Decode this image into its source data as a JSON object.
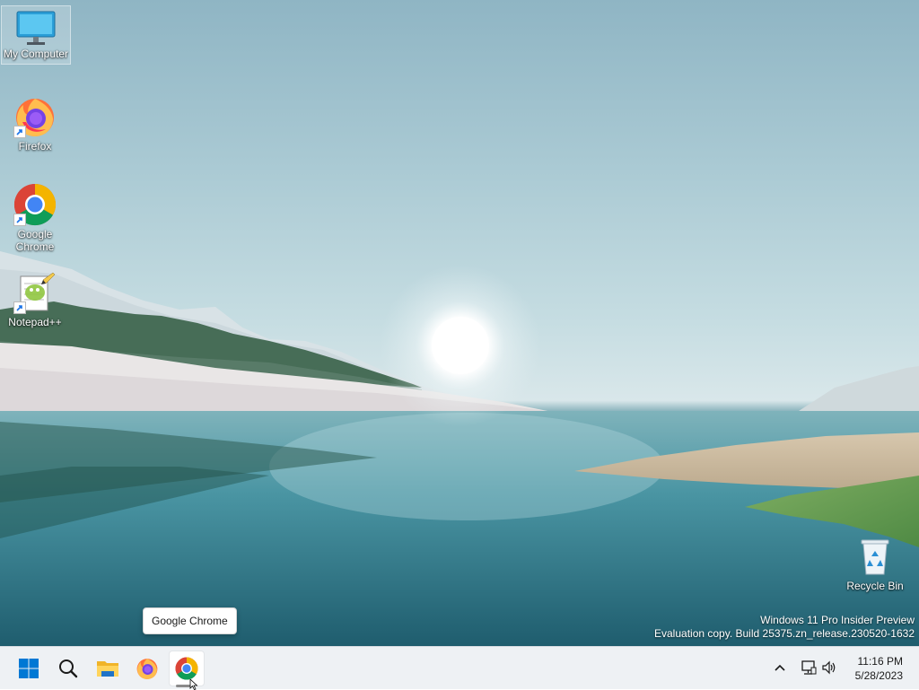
{
  "desktop_icons": [
    {
      "id": "my-computer",
      "label": "My Computer",
      "selected": true
    },
    {
      "id": "firefox",
      "label": "Firefox",
      "shortcut": true
    },
    {
      "id": "google-chrome",
      "label": "Google Chrome",
      "shortcut": true
    },
    {
      "id": "notepadpp",
      "label": "Notepad++",
      "shortcut": true
    },
    {
      "id": "recycle-bin",
      "label": "Recycle Bin"
    }
  ],
  "watermark": {
    "line1": "Windows 11 Pro Insider Preview",
    "line2": "Evaluation copy. Build 25375.zn_release.230520-1632"
  },
  "tooltip": {
    "text": "Google Chrome"
  },
  "taskbar": {
    "buttons": [
      {
        "name": "start",
        "icon": "windows-logo-icon"
      },
      {
        "name": "search",
        "icon": "search-icon"
      },
      {
        "name": "file-explorer",
        "icon": "folder-icon"
      },
      {
        "name": "firefox",
        "icon": "firefox-icon"
      },
      {
        "name": "google-chrome",
        "icon": "chrome-icon",
        "active": true
      }
    ],
    "tray_icons": [
      "chevron-up-icon",
      "network-icon",
      "volume-icon"
    ],
    "clock": {
      "time": "11:16 PM",
      "date": "5/28/2023"
    }
  },
  "colors": {
    "taskbar_bg": "#eef1f4",
    "windows_blue": "#0078d4",
    "chrome_red": "#db4437",
    "chrome_yellow": "#f4b400",
    "chrome_green": "#0f9d58",
    "chrome_blue": "#4285f4"
  }
}
